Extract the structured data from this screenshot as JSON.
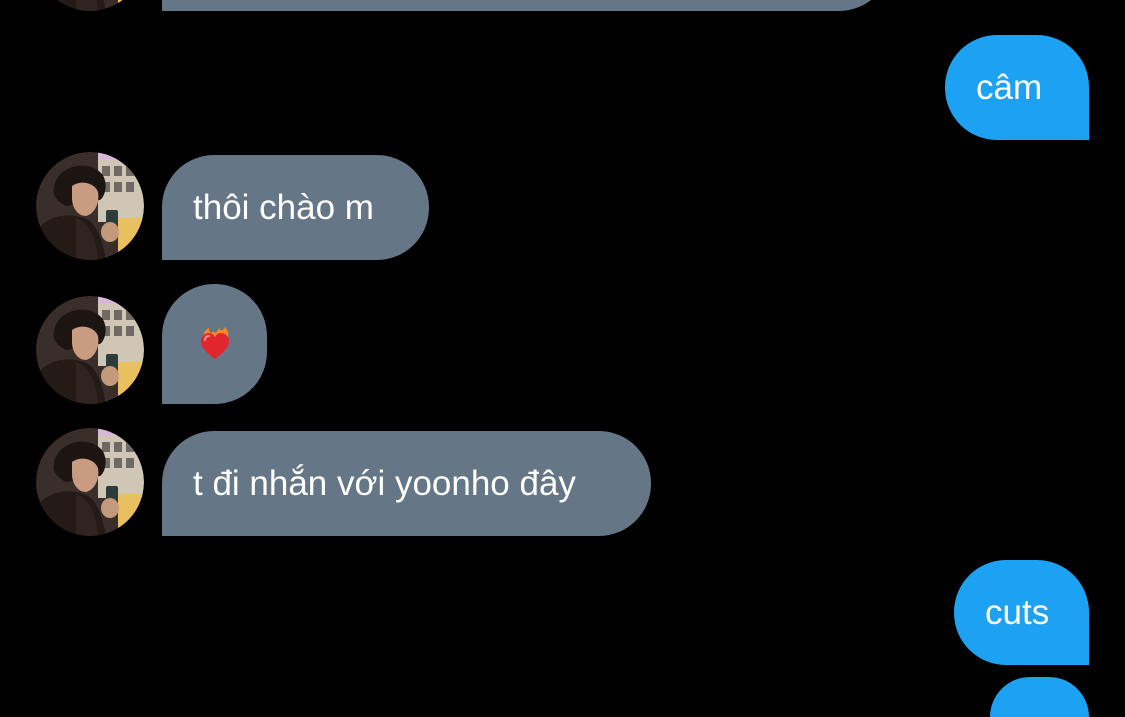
{
  "conversation": {
    "messages": [
      {
        "id": "m0",
        "direction": "received",
        "text": "",
        "partial": true
      },
      {
        "id": "m1",
        "direction": "sent",
        "text": "câm"
      },
      {
        "id": "m2",
        "direction": "received",
        "text": "thôi chào m"
      },
      {
        "id": "m3",
        "direction": "received",
        "emoji": "heart-on-fire",
        "text": ""
      },
      {
        "id": "m4",
        "direction": "received",
        "text": "t đi nhắn với yoonho đây"
      },
      {
        "id": "m5",
        "direction": "sent",
        "text": "cuts"
      },
      {
        "id": "m6",
        "direction": "sent",
        "text": "",
        "partial": true
      }
    ]
  },
  "theme": {
    "background": "#000000",
    "received_bubble": "#657786",
    "sent_bubble": "#1da1f2",
    "text": "#ffffff"
  }
}
